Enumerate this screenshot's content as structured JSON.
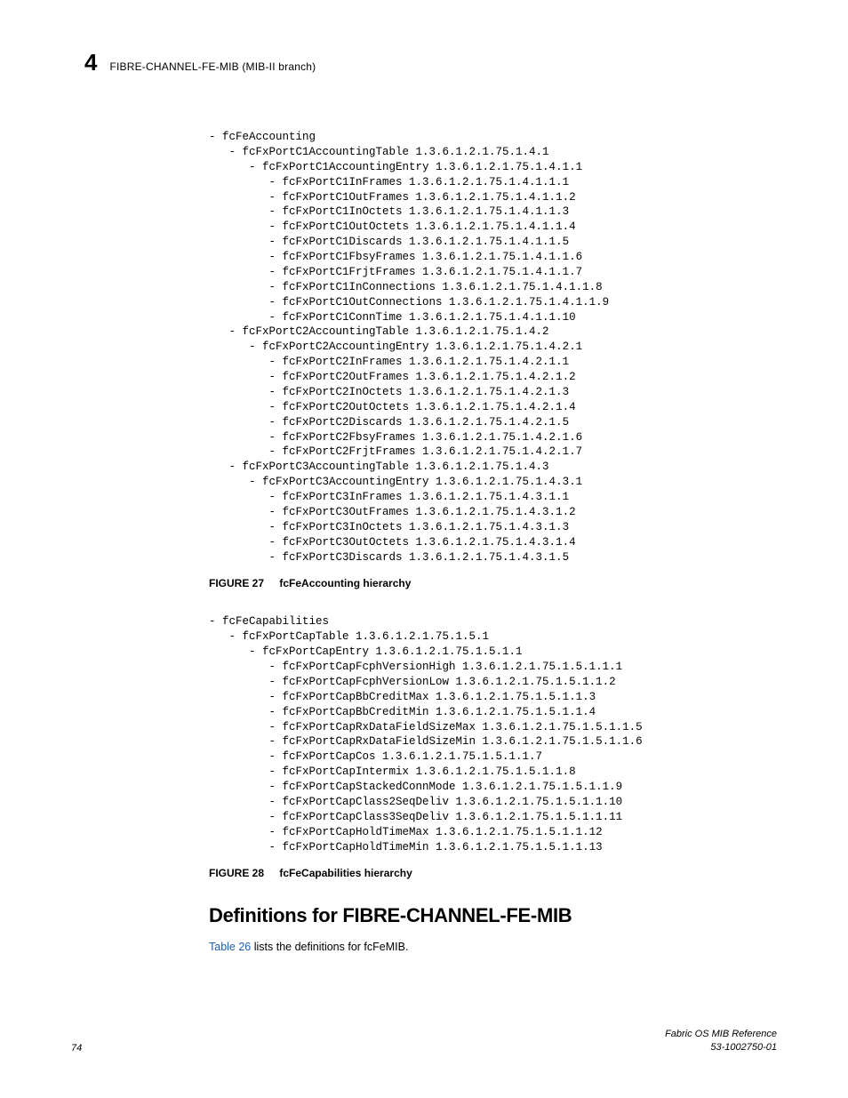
{
  "header": {
    "chapter_number": "4",
    "title": "FIBRE-CHANNEL-FE-MIB (MIB-II branch)"
  },
  "tree1": {
    "lines": [
      "- fcFeAccounting",
      "   - fcFxPortC1AccountingTable 1.3.6.1.2.1.75.1.4.1",
      "      - fcFxPortC1AccountingEntry 1.3.6.1.2.1.75.1.4.1.1",
      "         - fcFxPortC1InFrames 1.3.6.1.2.1.75.1.4.1.1.1",
      "         - fcFxPortC1OutFrames 1.3.6.1.2.1.75.1.4.1.1.2",
      "         - fcFxPortC1InOctets 1.3.6.1.2.1.75.1.4.1.1.3",
      "         - fcFxPortC1OutOctets 1.3.6.1.2.1.75.1.4.1.1.4",
      "         - fcFxPortC1Discards 1.3.6.1.2.1.75.1.4.1.1.5",
      "         - fcFxPortC1FbsyFrames 1.3.6.1.2.1.75.1.4.1.1.6",
      "         - fcFxPortC1FrjtFrames 1.3.6.1.2.1.75.1.4.1.1.7",
      "         - fcFxPortC1InConnections 1.3.6.1.2.1.75.1.4.1.1.8",
      "         - fcFxPortC1OutConnections 1.3.6.1.2.1.75.1.4.1.1.9",
      "         - fcFxPortC1ConnTime 1.3.6.1.2.1.75.1.4.1.1.10",
      "   - fcFxPortC2AccountingTable 1.3.6.1.2.1.75.1.4.2",
      "      - fcFxPortC2AccountingEntry 1.3.6.1.2.1.75.1.4.2.1",
      "         - fcFxPortC2InFrames 1.3.6.1.2.1.75.1.4.2.1.1",
      "         - fcFxPortC2OutFrames 1.3.6.1.2.1.75.1.4.2.1.2",
      "         - fcFxPortC2InOctets 1.3.6.1.2.1.75.1.4.2.1.3",
      "         - fcFxPortC2OutOctets 1.3.6.1.2.1.75.1.4.2.1.4",
      "         - fcFxPortC2Discards 1.3.6.1.2.1.75.1.4.2.1.5",
      "         - fcFxPortC2FbsyFrames 1.3.6.1.2.1.75.1.4.2.1.6",
      "         - fcFxPortC2FrjtFrames 1.3.6.1.2.1.75.1.4.2.1.7",
      "   - fcFxPortC3AccountingTable 1.3.6.1.2.1.75.1.4.3",
      "      - fcFxPortC3AccountingEntry 1.3.6.1.2.1.75.1.4.3.1",
      "         - fcFxPortC3InFrames 1.3.6.1.2.1.75.1.4.3.1.1",
      "         - fcFxPortC3OutFrames 1.3.6.1.2.1.75.1.4.3.1.2",
      "         - fcFxPortC3InOctets 1.3.6.1.2.1.75.1.4.3.1.3",
      "         - fcFxPortC3OutOctets 1.3.6.1.2.1.75.1.4.3.1.4",
      "         - fcFxPortC3Discards 1.3.6.1.2.1.75.1.4.3.1.5"
    ]
  },
  "figure27": {
    "label": "FIGURE 27",
    "title": "fcFeAccounting hierarchy"
  },
  "tree2": {
    "lines": [
      "- fcFeCapabilities",
      "   - fcFxPortCapTable 1.3.6.1.2.1.75.1.5.1",
      "      - fcFxPortCapEntry 1.3.6.1.2.1.75.1.5.1.1",
      "         - fcFxPortCapFcphVersionHigh 1.3.6.1.2.1.75.1.5.1.1.1",
      "         - fcFxPortCapFcphVersionLow 1.3.6.1.2.1.75.1.5.1.1.2",
      "         - fcFxPortCapBbCreditMax 1.3.6.1.2.1.75.1.5.1.1.3",
      "         - fcFxPortCapBbCreditMin 1.3.6.1.2.1.75.1.5.1.1.4",
      "         - fcFxPortCapRxDataFieldSizeMax 1.3.6.1.2.1.75.1.5.1.1.5",
      "         - fcFxPortCapRxDataFieldSizeMin 1.3.6.1.2.1.75.1.5.1.1.6",
      "         - fcFxPortCapCos 1.3.6.1.2.1.75.1.5.1.1.7",
      "         - fcFxPortCapIntermix 1.3.6.1.2.1.75.1.5.1.1.8",
      "         - fcFxPortCapStackedConnMode 1.3.6.1.2.1.75.1.5.1.1.9",
      "         - fcFxPortCapClass2SeqDeliv 1.3.6.1.2.1.75.1.5.1.1.10",
      "         - fcFxPortCapClass3SeqDeliv 1.3.6.1.2.1.75.1.5.1.1.11",
      "         - fcFxPortCapHoldTimeMax 1.3.6.1.2.1.75.1.5.1.1.12",
      "         - fcFxPortCapHoldTimeMin 1.3.6.1.2.1.75.1.5.1.1.13"
    ]
  },
  "figure28": {
    "label": "FIGURE 28",
    "title": "fcFeCapabilities hierarchy"
  },
  "section": {
    "heading": "Definitions for FIBRE-CHANNEL-FE-MIB",
    "table_ref": "Table 26",
    "body_rest": " lists the definitions for fcFeMIB."
  },
  "footer": {
    "page": "74",
    "doc_title": "Fabric OS MIB Reference",
    "doc_id": "53-1002750-01"
  }
}
